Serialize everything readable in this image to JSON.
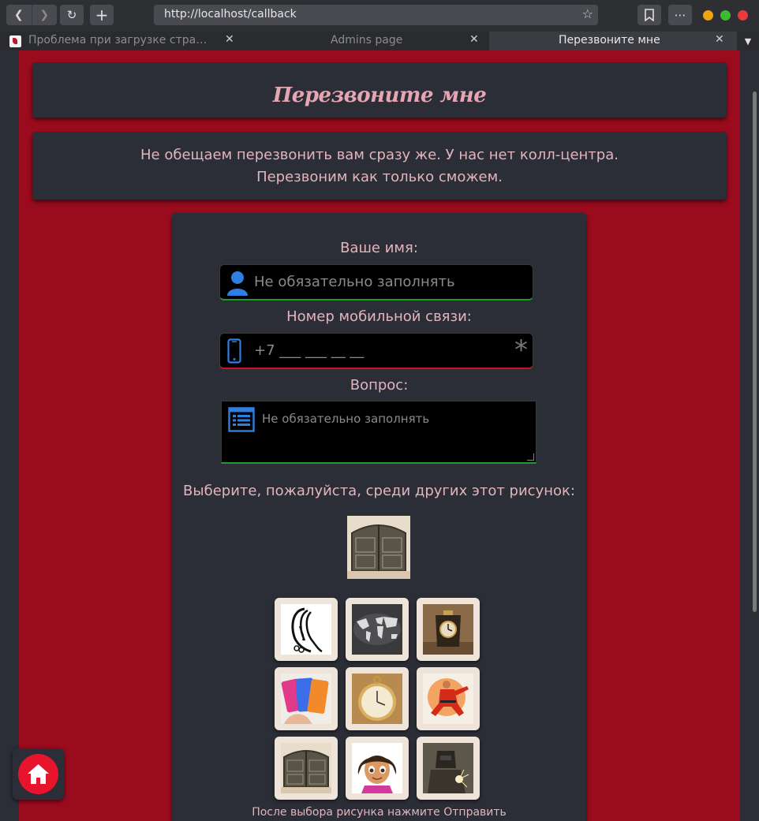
{
  "browser": {
    "url": "http://localhost/callback",
    "tabs": [
      {
        "label": "Проблема при загрузке стра…",
        "active": false
      },
      {
        "label": "Admins page",
        "active": false
      },
      {
        "label": "Перезвоните мне",
        "active": true
      }
    ],
    "close_glyph": "✕"
  },
  "page": {
    "heading": "Перезвоните мне",
    "notice_line1": "Не обещаем перезвонить вам сразу же. У нас нет колл-центра.",
    "notice_line2": "Перезвоним как только сможем.",
    "accent_color": "#e8142b",
    "background_color": "#9b0b1e",
    "card_color": "#2b2e36"
  },
  "form": {
    "name_label": "Ваше имя:",
    "name_placeholder": "Не обязательно заполнять",
    "phone_label": "Номер мобильной связи:",
    "phone_placeholder": "+7 ___ ___ __ __",
    "phone_required_mark": "*",
    "question_label": "Вопрос:",
    "question_placeholder": "Не обязательно заполнять",
    "captcha_prompt": "Выберите, пожалуйста, среди других этот рисунок:",
    "captcha_target": "gate",
    "captcha_options": [
      "hair-salon",
      "world-map",
      "mantel-clock",
      "smartphones",
      "pocket-watch",
      "martial-arts",
      "gate",
      "cartoon-girl",
      "welder"
    ],
    "footnote": "После выбора рисунка нажмите Отправить"
  }
}
